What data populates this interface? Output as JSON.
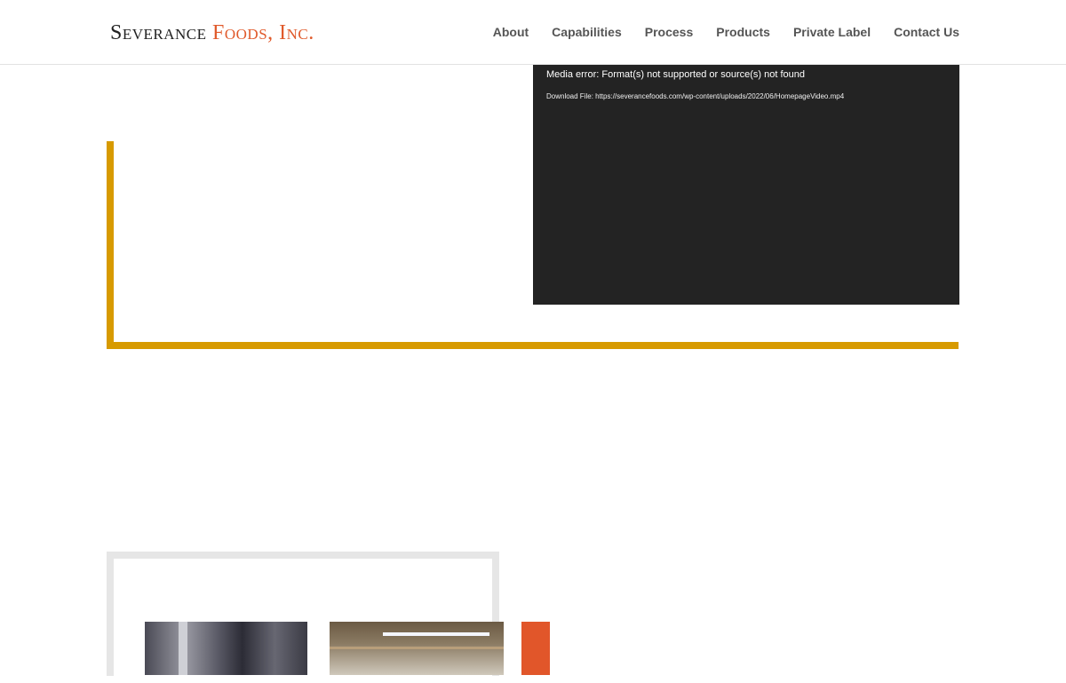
{
  "logo": {
    "part1": "Severance",
    "part2": "Foods, Inc."
  },
  "nav": {
    "items": [
      {
        "label": "About"
      },
      {
        "label": "Capabilities"
      },
      {
        "label": "Process"
      },
      {
        "label": "Products"
      },
      {
        "label": "Private Label"
      },
      {
        "label": "Contact Us"
      }
    ]
  },
  "video": {
    "error_text": "Media error: Format(s) not supported or source(s) not found",
    "download_text": "Download File: https://severancefoods.com/wp-content/uploads/2022/06/HomepageVideo.mp4"
  },
  "colors": {
    "gold_accent": "#d79a00",
    "brand_orange": "#e05a2b",
    "video_bg": "#232323"
  }
}
